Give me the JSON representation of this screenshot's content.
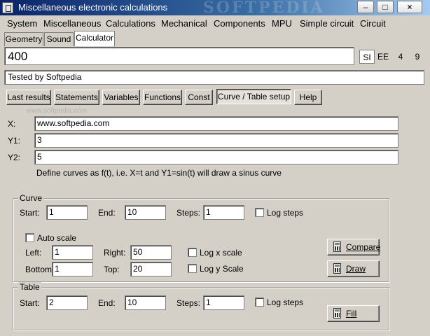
{
  "window": {
    "title": "Miscellaneous electronic calculations",
    "watermark": "SOFTPEDIA",
    "minimize": "–",
    "maximize": "□",
    "close": "×"
  },
  "menu": [
    "System",
    "Miscellaneous",
    "Calculations",
    "Mechanical",
    "Components",
    "MPU",
    "Simple circuit",
    "Circuit"
  ],
  "tabs": [
    "Geometry",
    "Sound",
    "Calculator"
  ],
  "display": {
    "value": "400",
    "units": [
      "SI",
      "EE",
      "4",
      "9"
    ],
    "selected_unit": "SI"
  },
  "test_line": "Tested by Softpedia",
  "buttons": [
    "Last results",
    "Statements",
    "Variables",
    "Functions",
    "Const",
    "Curve / Table setup",
    "Help"
  ],
  "active_button": "Curve / Table setup",
  "watermark_small": "www.softpedia.com",
  "expressions": {
    "x_label": "X:",
    "x_value": "www.softpedia.com",
    "y1_label": "Y1:",
    "y1_value": "3",
    "y2_label": "Y2:",
    "y2_value": "5",
    "hint": "Define curves as f(t), i.e.  X=t and Y1=sin(t) will draw a sinus curve"
  },
  "curve": {
    "title": "Curve",
    "start_label": "Start:",
    "start": "1",
    "end_label": "End:",
    "end": "10",
    "steps_label": "Steps:",
    "steps": "1",
    "log_steps": "Log steps",
    "auto_scale": "Auto scale",
    "left_label": "Left:",
    "left": "1",
    "right_label": "Right:",
    "right": "50",
    "bottom_label": "Bottom:",
    "bottom": "1",
    "top_label": "Top:",
    "top": "20",
    "log_x": "Log x scale",
    "log_y": "Log y Scale",
    "compare": "Compare",
    "draw": "Draw"
  },
  "table": {
    "title": "Table",
    "start_label": "Start:",
    "start": "2",
    "end_label": "End:",
    "end": "10",
    "steps_label": "Steps:",
    "steps": "1",
    "log_steps": "Log steps",
    "fill": "Fill"
  }
}
